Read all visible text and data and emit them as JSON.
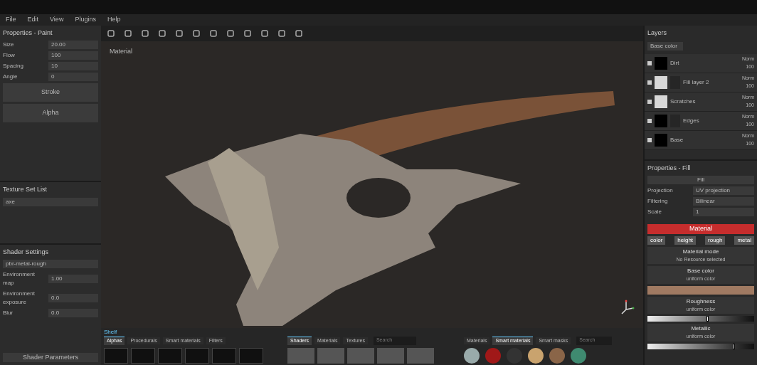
{
  "menu": [
    "File",
    "Edit",
    "View",
    "Plugins",
    "Help"
  ],
  "properties_paint": {
    "title": "Properties - Paint",
    "fields": [
      {
        "label": "Size",
        "value": "20.00"
      },
      {
        "label": "Flow",
        "value": "100"
      },
      {
        "label": "Spacing",
        "value": "10"
      },
      {
        "label": "Angle",
        "value": "0"
      }
    ],
    "buttons": [
      "Stroke",
      "Alpha"
    ]
  },
  "texture_set_list": {
    "title": "Texture Set List",
    "item": "axe"
  },
  "shader_settings": {
    "title": "Shader Settings",
    "shader": "pbr-metal-rough",
    "rows": [
      {
        "label": "Environment map",
        "value": "1.00"
      },
      {
        "label": "Environment exposure",
        "value": "0.0"
      },
      {
        "label": "Blur",
        "value": "0.0"
      }
    ],
    "footer": "Shader Parameters"
  },
  "viewport": {
    "label": "Material"
  },
  "layers": {
    "title": "Layers",
    "blend": "Base color",
    "rows": [
      {
        "name": "Dirt",
        "blend": "Norm",
        "opacity": "100",
        "mask": false,
        "light_thumbnail": false
      },
      {
        "name": "Fill layer 2",
        "blend": "Norm",
        "opacity": "100",
        "mask": true,
        "light_thumbnail": true
      },
      {
        "name": "Scratches",
        "blend": "Norm",
        "opacity": "100",
        "mask": false,
        "light_thumbnail": true
      },
      {
        "name": "Edges",
        "blend": "Norm",
        "opacity": "100",
        "mask": true,
        "light_thumbnail": false
      },
      {
        "name": "Base",
        "blend": "Norm",
        "opacity": "100",
        "mask": false,
        "light_thumbnail": false
      }
    ]
  },
  "properties_fill": {
    "title": "Properties - Fill",
    "section": "Fill",
    "fields": [
      {
        "label": "Projection",
        "value": "UV projection"
      },
      {
        "label": "Filtering",
        "value": "Bilinear"
      },
      {
        "label": "Scale",
        "value": "1"
      }
    ],
    "material": "Material",
    "channels": [
      {
        "label": "color",
        "on": true
      },
      {
        "label": "height",
        "on": true
      },
      {
        "label": "rough",
        "on": true
      },
      {
        "label": "metal",
        "on": true
      }
    ],
    "mode": {
      "title": "Material mode",
      "subtitle": "No Resource selected"
    },
    "base_color": {
      "title": "Base color",
      "subtitle": "uniform color",
      "color": "#a07a62"
    },
    "roughness": {
      "title": "Roughness",
      "subtitle": "uniform color",
      "level": 0.55
    },
    "metallic": {
      "title": "Metallic",
      "subtitle": "uniform color",
      "level": 0.8
    }
  },
  "shelf": {
    "title": "Shelf",
    "tabs": [
      {
        "label": "Alphas",
        "selected": true
      },
      {
        "label": "Procedurals",
        "selected": false
      },
      {
        "label": "Smart materials",
        "selected": false
      },
      {
        "label": "Filters",
        "selected": false
      }
    ],
    "mid_tabs": [
      {
        "label": "Shaders",
        "selected": true
      },
      {
        "label": "Materials",
        "selected": false
      },
      {
        "label": "Textures",
        "selected": false
      }
    ],
    "right_tabs": [
      {
        "label": "Materials",
        "selected": false
      },
      {
        "label": "Smart materials",
        "selected": true
      },
      {
        "label": "Smart masks",
        "selected": false
      }
    ],
    "search_textures": "Search",
    "search_materials": "Search"
  }
}
